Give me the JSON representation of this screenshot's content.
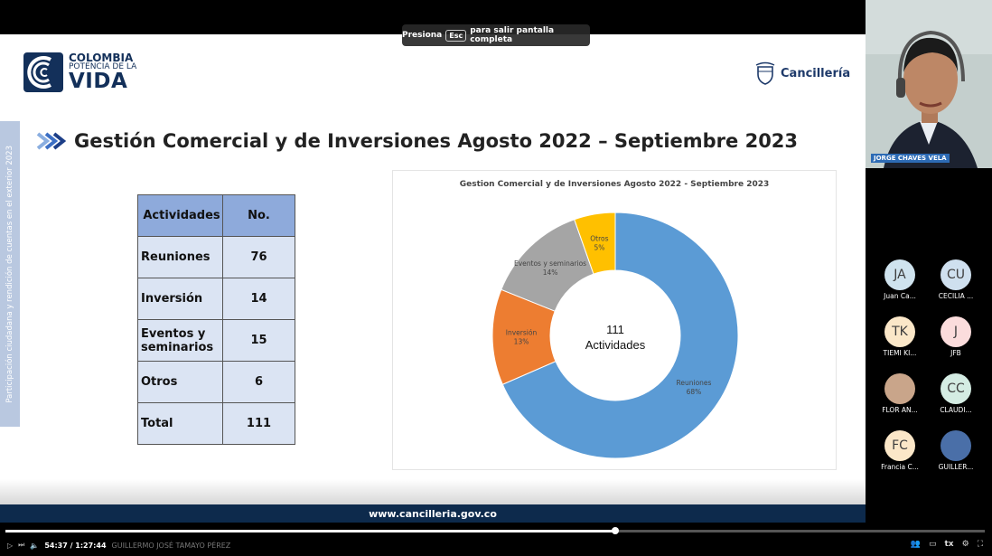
{
  "fullscreen_banner": {
    "prefix": "Presiona",
    "key": "Esc",
    "suffix": "para salir pantalla completa"
  },
  "logo_left": {
    "line1": "COLOMBIA",
    "line2": "POTENCIA DE LA",
    "line3": "VIDA"
  },
  "logo_right": {
    "text": "Cancillería"
  },
  "side_tab": "Participación ciudadana y rendición de cuentas en el exterior 2023",
  "slide_title": "Gestión Comercial y de Inversiones Agosto 2022 – Septiembre 2023",
  "table": {
    "headers": [
      "Actividades",
      "No."
    ],
    "rows": [
      {
        "label": "Reuniones",
        "value": "76"
      },
      {
        "label": "Inversión",
        "value": "14"
      },
      {
        "label": "Eventos y seminarios",
        "value": "15"
      },
      {
        "label": "Otros",
        "value": "6"
      },
      {
        "label": "Total",
        "value": "111"
      }
    ]
  },
  "chart_data": {
    "type": "pie",
    "title": "Gestion Comercial y de Inversiones Agosto 2022 - Septiembre 2023",
    "center_value": "111",
    "center_label": "Actividades",
    "categories": [
      "Reuniones",
      "Inversión",
      "Eventos y seminarios",
      "Otros"
    ],
    "values": [
      76,
      14,
      15,
      6
    ],
    "percent_labels": [
      "68%",
      "13%",
      "14%",
      "5%"
    ],
    "colors": [
      "#5b9bd5",
      "#ed7d31",
      "#a5a5a5",
      "#ffc000"
    ]
  },
  "footer_url": "www.cancilleria.gov.co",
  "speaker": {
    "name": "JORGE CHAVES VELA"
  },
  "participants": [
    {
      "initials": "JA",
      "name": "Juan Ca...",
      "color": "#cfe3ee"
    },
    {
      "initials": "CU",
      "name": "CECILIA ...",
      "color": "#cfe0ef"
    },
    {
      "initials": "TK",
      "name": "TIEMI KI...",
      "color": "#fbe7c8"
    },
    {
      "initials": "J",
      "name": "JFB",
      "color": "#fbdcdc"
    },
    {
      "initials": "",
      "name": "FLOR AN...",
      "color": "#c9a58a"
    },
    {
      "initials": "CC",
      "name": "CLAUDI...",
      "color": "#d4ece3"
    },
    {
      "initials": "FC",
      "name": "Francia C...",
      "color": "#fbe7c8"
    },
    {
      "initials": "",
      "name": "GUILLER...",
      "color": "#4a6fa8"
    }
  ],
  "player": {
    "presenter_name": "GUILLERMO JOSÉ TAMAYO PÉREZ",
    "time": "54:37 / 1:27:44",
    "progress": 0.623,
    "captions": "tx"
  }
}
